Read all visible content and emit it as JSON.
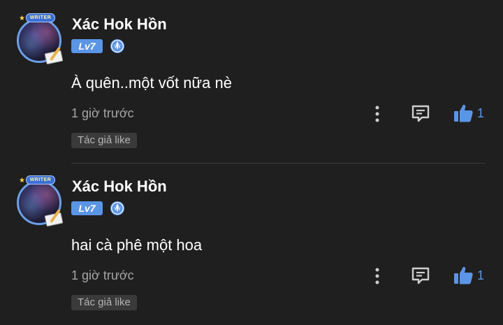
{
  "comments": [
    {
      "avatar_badge": "WRITER",
      "username": "Xác Hok Hồn",
      "level": "Lv7",
      "text": "À quên..một vốt nữa nè",
      "time": "1 giờ trước",
      "like_count": "1",
      "author_like_label": "Tác giả like"
    },
    {
      "avatar_badge": "WRITER",
      "username": "Xác Hok Hồn",
      "level": "Lv7",
      "text": "hai cà phê một hoa",
      "time": "1 giờ trước",
      "like_count": "1",
      "author_like_label": "Tác giả like"
    }
  ],
  "colors": {
    "background": "#1f1f1f",
    "accent": "#5b95e6",
    "muted_text": "#a6a6a6",
    "tag_background": "#3a3a3a"
  },
  "icons": [
    "more-vertical-icon",
    "reply-comment-icon",
    "thumbs-up-icon",
    "rank-emblem-icon",
    "writer-avatar-frame"
  ]
}
